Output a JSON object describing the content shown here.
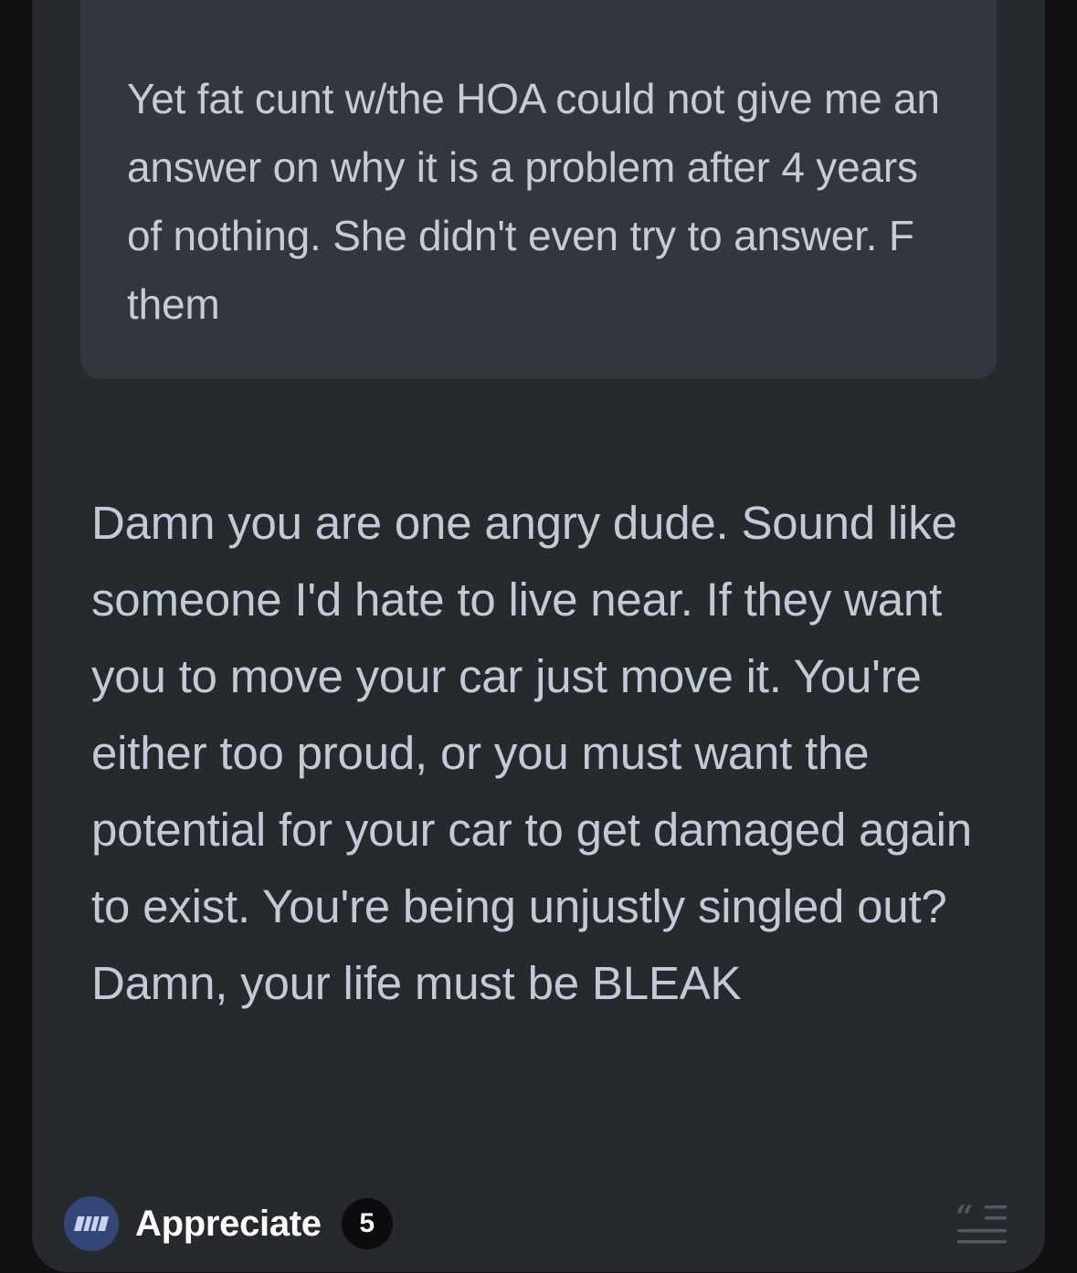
{
  "quoted_comment": {
    "text": "Yet fat cunt w/the HOA could not give me an answer on why it is a problem after 4 years of nothing. She didn't even try to answer. F them"
  },
  "comment": {
    "text": "Damn you are one angry dude. Sound like someone I'd hate to live near. If they want you to move your car just move it. You're either too proud, or you must want the potential for your car to get damaged again to exist. You're being unjustly singled out? Damn, your life must be BLEAK"
  },
  "footer": {
    "appreciate_label": "Appreciate",
    "appreciate_count": "5",
    "appreciate_icon": "appreciate-icon",
    "quote_icon": "quote-reply-icon"
  },
  "colors": {
    "background": "#0f1012",
    "card": "#26292e",
    "quote_box": "#33363f",
    "text": "#c3cad7",
    "accent": "#344677"
  }
}
